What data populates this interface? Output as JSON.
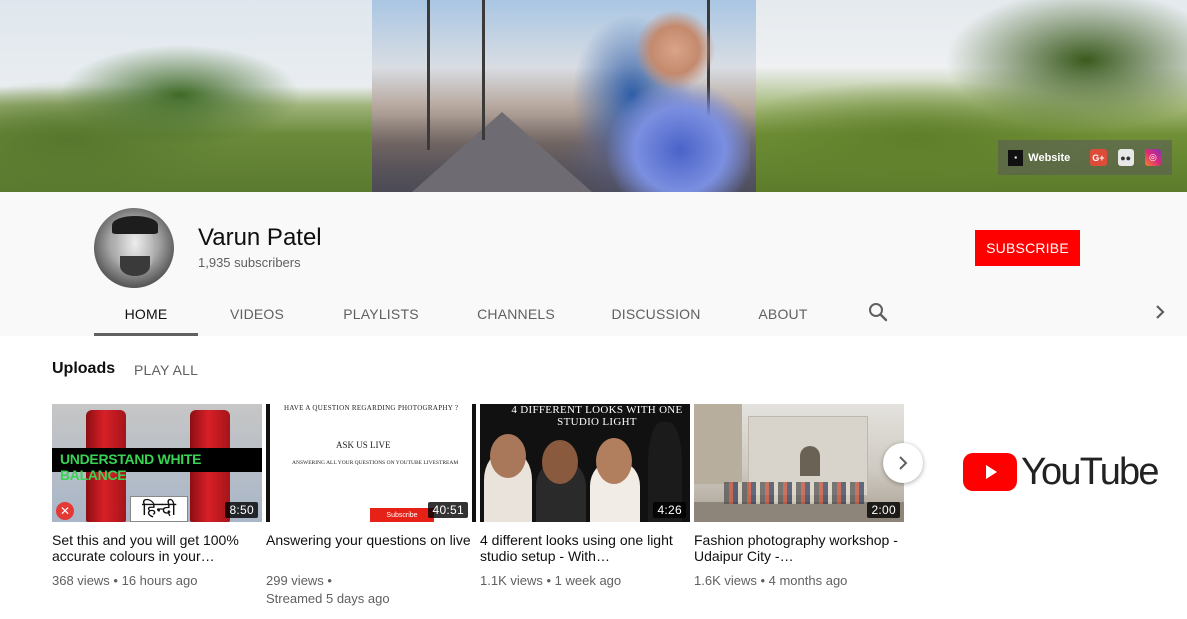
{
  "banner": {
    "links": {
      "website_label": "Website",
      "website_icon": "website-icon",
      "gplus_label": "G+",
      "gplus_icon": "google-plus-icon",
      "flickr_icon": "flickr-icon",
      "instagram_icon": "instagram-icon"
    }
  },
  "channel": {
    "name": "Varun Patel",
    "subscribers": "1,935 subscribers",
    "subscribe_label": "SUBSCRIBE",
    "subscribe_color": "#ff0000"
  },
  "tabs": [
    {
      "label": "HOME",
      "active": true
    },
    {
      "label": "VIDEOS",
      "active": false
    },
    {
      "label": "PLAYLISTS",
      "active": false
    },
    {
      "label": "CHANNELS",
      "active": false
    },
    {
      "label": "DISCUSSION",
      "active": false
    },
    {
      "label": "ABOUT",
      "active": false
    }
  ],
  "shelf": {
    "title": "Uploads",
    "play_all": "PLAY ALL",
    "videos": [
      {
        "title": "Set this and you will get 100% accurate colours in your…",
        "meta_line1": "368 views • 16 hours ago",
        "meta_line2": "",
        "duration": "8:50",
        "thumb_text": "UNDERSTAND WHITE BALANCE",
        "thumb_text2": "हिन्दी"
      },
      {
        "title": "Answering your questions on live",
        "meta_line1": "299 views •",
        "meta_line2": "Streamed 5 days ago",
        "duration": "40:51",
        "thumb_text": "HAVE A QUESTION REGARDING PHOTOGRAPHY ?",
        "thumb_text2": "ASK US LIVE",
        "thumb_text3": "ANSWERING ALL YOUR QUESTIONS ON YOUTUBE LIVESTREAM",
        "thumb_button": "Subscribe"
      },
      {
        "title": "4 different looks using one light studio setup - With…",
        "meta_line1": "1.1K views • 1 week ago",
        "meta_line2": "",
        "duration": "4:26",
        "thumb_text": "4 DIFFERENT LOOKS WITH ONE STUDIO LIGHT"
      },
      {
        "title": "Fashion photography workshop - Udaipur City -…",
        "meta_line1": "1.6K views • 4 months ago",
        "meta_line2": "",
        "duration": "2:00"
      }
    ]
  },
  "logo": {
    "text": "YouTube",
    "color": "#ff0000"
  }
}
